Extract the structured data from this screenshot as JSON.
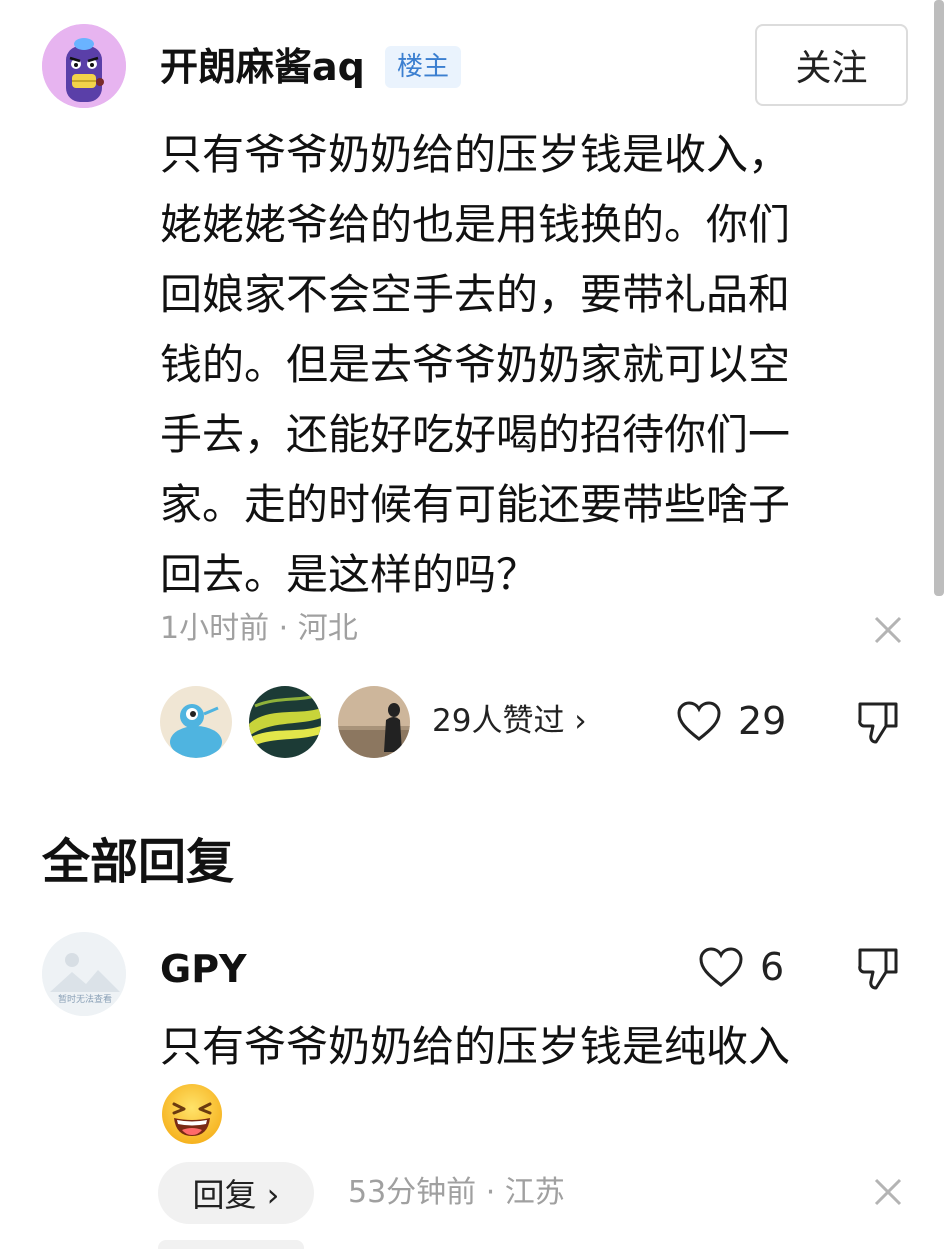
{
  "post": {
    "author": "开朗麻酱aq",
    "badge": "楼主",
    "follow_label": "关注",
    "body": "只有爷爷奶奶给的压岁钱是收入，\n姥姥姥爷给的也是用钱换的。你们\n回娘家不会空手去的，要带礼品和\n钱的。但是去爷爷奶奶家就可以空\n手去，还能好吃好喝的招待你们一\n家。走的时候有可能还要带些啥子\n回去。是这样的吗？",
    "meta": "1小时前 · 河北",
    "liked_by": "29人赞过 ›",
    "like_count": "29"
  },
  "section": {
    "title": "全部回复"
  },
  "reply": {
    "author": "GPY",
    "avatar_placeholder": "暂时无法查看",
    "like_count": "6",
    "body": "只有爷爷奶奶给的压岁钱是纯收入",
    "reply_label": "回复 ›",
    "meta": "53分钟前 · 江苏"
  },
  "colors": {
    "badge_bg": "#eaf3fd",
    "badge_text": "#3b7fd0",
    "meta_text": "#a0a0a0"
  }
}
